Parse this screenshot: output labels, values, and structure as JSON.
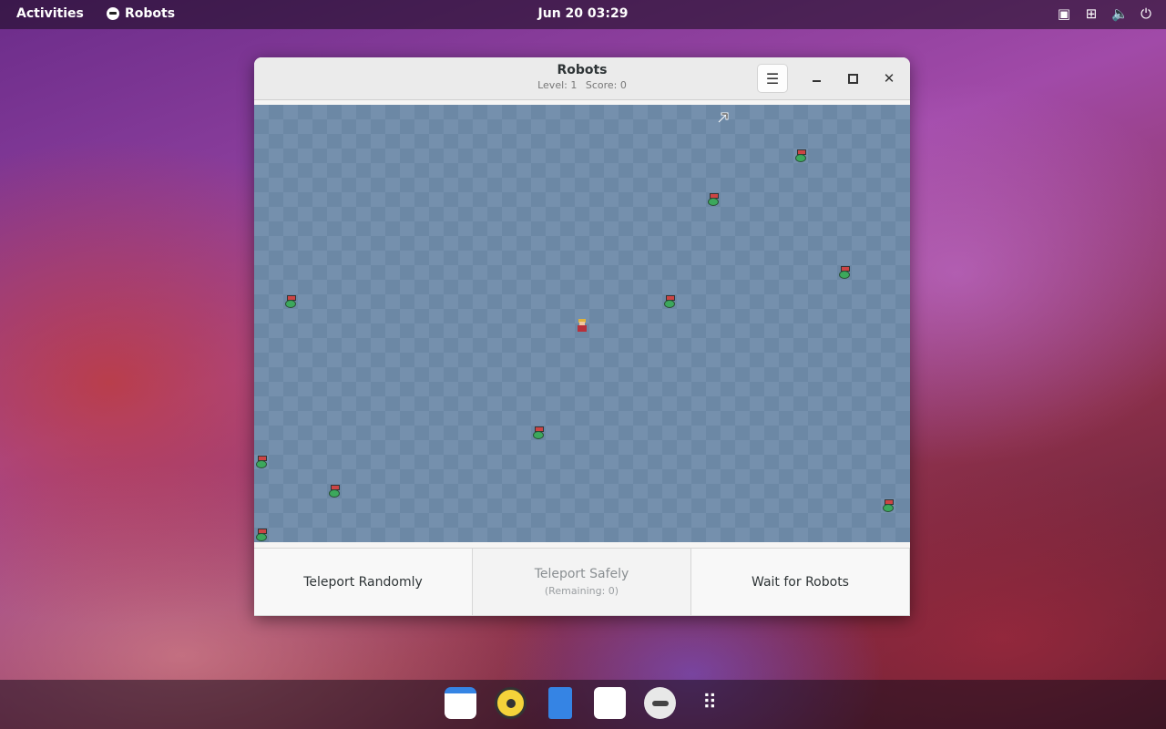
{
  "topbar": {
    "activities": "Activities",
    "app_name": "Robots",
    "clock": "Jun 20  03:29"
  },
  "window": {
    "title": "Robots",
    "level_label": "Level: 1",
    "score_label": "Score: 0"
  },
  "board": {
    "player": {
      "col": 22.5,
      "row": 15.1
    },
    "robots": [
      {
        "col": 37.5,
        "row": 3.5
      },
      {
        "col": 31.5,
        "row": 6.5
      },
      {
        "col": 40.5,
        "row": 11.5
      },
      {
        "col": 2.5,
        "row": 13.5
      },
      {
        "col": 28.5,
        "row": 13.5
      },
      {
        "col": 19.5,
        "row": 22.5
      },
      {
        "col": 0.5,
        "row": 24.5
      },
      {
        "col": 5.5,
        "row": 26.5
      },
      {
        "col": 43.5,
        "row": 27.5
      },
      {
        "col": 0.5,
        "row": 29.5
      }
    ]
  },
  "actions": {
    "teleport_randomly": "Teleport Randomly",
    "teleport_safely": "Teleport Safely",
    "teleport_safely_remaining": "(Remaining: 0)",
    "wait": "Wait for Robots"
  },
  "dock": {
    "items": [
      "calendar-icon",
      "rhythmbox-icon",
      "files-icon",
      "software-icon",
      "robots-icon",
      "show-apps-icon"
    ]
  }
}
